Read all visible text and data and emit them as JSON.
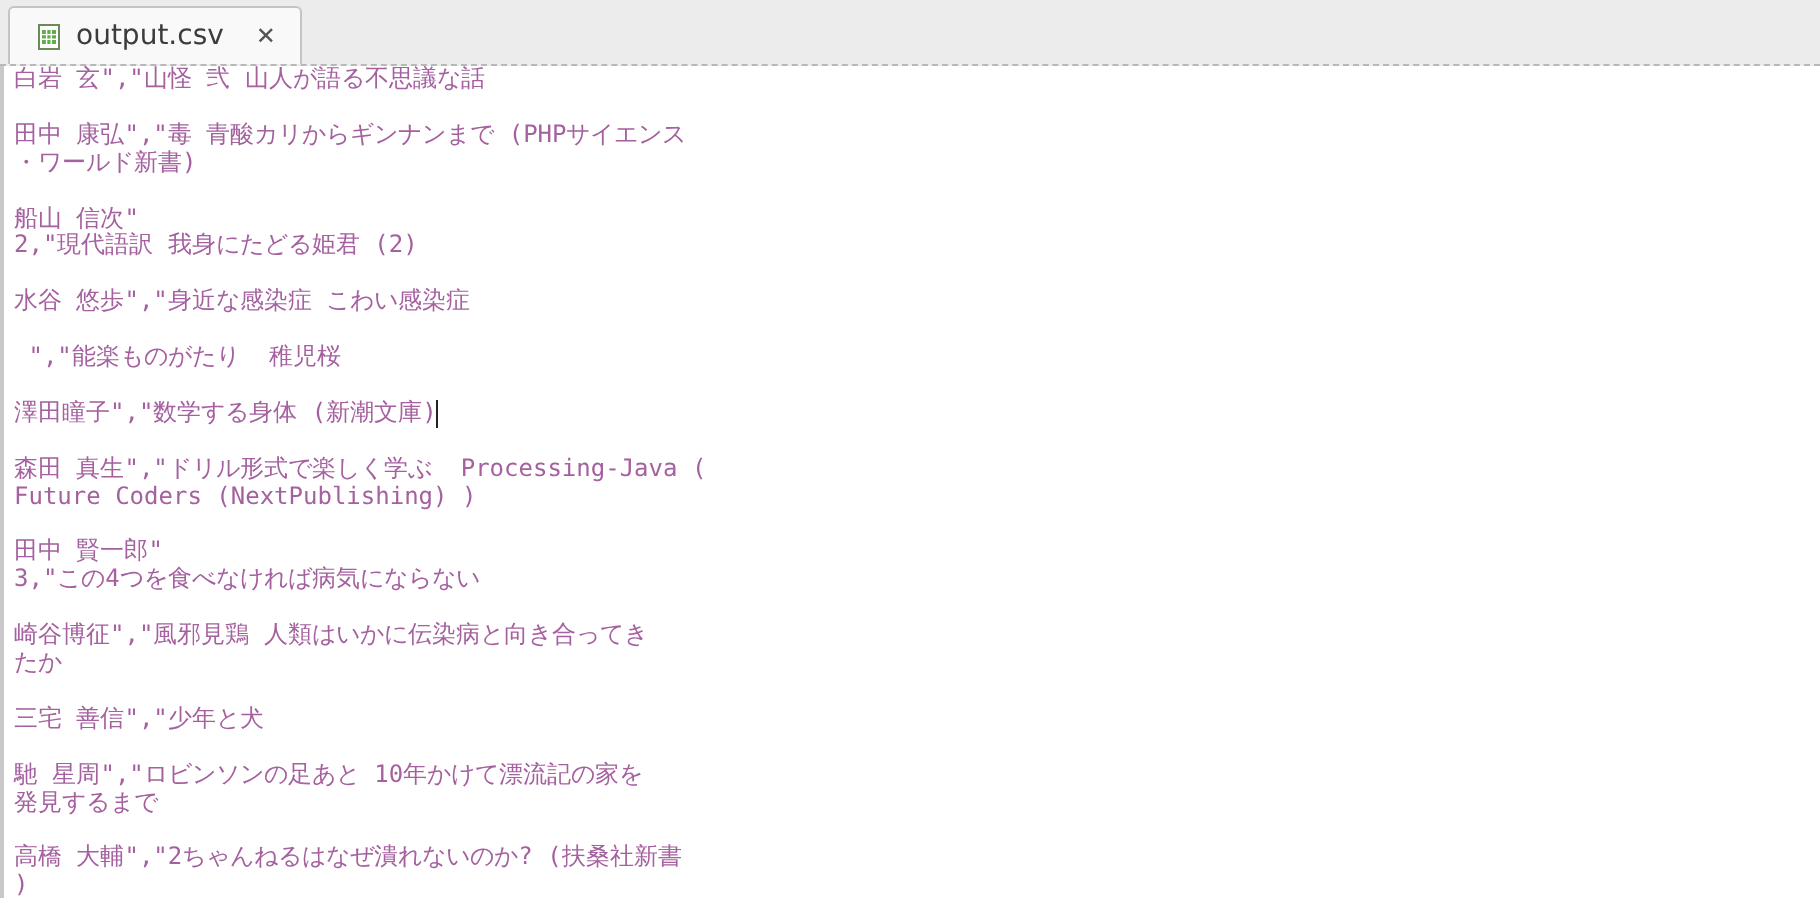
{
  "tabs": [
    {
      "label": "output.csv",
      "close": "✕",
      "selected": true
    }
  ],
  "records": [
    {
      "lines": [
        "白岩 玄\",\"山怪 弐 山人が語る不思議な話"
      ],
      "cursor": false
    },
    {
      "lines": [
        "田中 康弘\",\"毒 青酸カリからギンナンまで (PHPサイエンス",
        "・ワールド新書)"
      ],
      "cursor": false
    },
    {
      "lines": [
        "船山 信次\"",
        "2,\"現代語訳 我身にたどる姫君 (2)"
      ],
      "cursor": false
    },
    {
      "lines": [
        "水谷 悠歩\",\"身近な感染症 こわい感染症"
      ],
      "cursor": false
    },
    {
      "lines": [
        " \",\"能楽ものがたり  稚児桜"
      ],
      "cursor": false
    },
    {
      "lines": [
        "澤田瞳子\",\"数学する身体 (新潮文庫)"
      ],
      "cursor": true
    },
    {
      "lines": [
        "森田 真生\",\"ドリル形式で楽しく学ぶ  Processing-Java (",
        "Future Coders (NextPublishing) )"
      ],
      "cursor": false
    },
    {
      "lines": [
        "田中 賢一郎\"",
        "3,\"この4つを食べなければ病気にならない"
      ],
      "cursor": false
    },
    {
      "lines": [
        "崎谷博征\",\"風邪見鶏 人類はいかに伝染病と向き合ってき",
        "たか"
      ],
      "cursor": false
    },
    {
      "lines": [
        "三宅 善信\",\"少年と犬"
      ],
      "cursor": false
    },
    {
      "lines": [
        "馳 星周\",\"ロビンソンの足あと 10年かけて漂流記の家を",
        "発見するまで"
      ],
      "cursor": false
    },
    {
      "lines": [
        "高橋 大輔\",\"2ちゃんねるはなぜ潰れないのか? (扶桑社新書",
        ")"
      ],
      "cursor": false
    }
  ]
}
